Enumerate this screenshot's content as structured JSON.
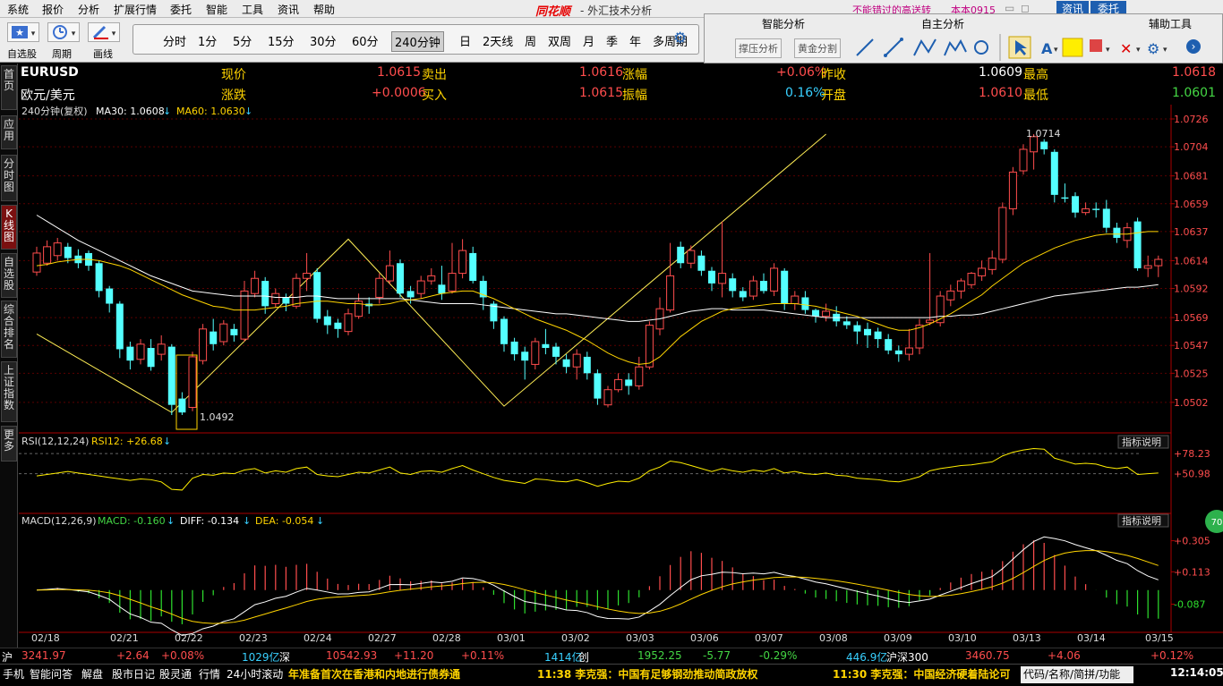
{
  "menu": [
    "系统",
    "报价",
    "分析",
    "扩展行情",
    "委托",
    "智能",
    "工具",
    "资讯",
    "帮助"
  ],
  "brand": "同花顺",
  "app_title": "- 外汇技术分析",
  "promo": "不能错过的高送转",
  "account": "本本0915",
  "top_buttons": [
    "资讯",
    "委托"
  ],
  "toolbar": {
    "watchlist": "自选股",
    "cycle": "周期",
    "draw": "画线"
  },
  "periods": [
    "分时",
    "1分",
    "5分",
    "15分",
    "30分",
    "60分",
    "240分钟",
    "日",
    "2天线",
    "周",
    "双周",
    "月",
    "季",
    "年",
    "多周期"
  ],
  "active_period": "240分钟",
  "right_panel": {
    "smart": "智能分析",
    "self": "自主分析",
    "aux": "辅助工具",
    "btn1": "撑压分析",
    "btn2": "黄金分割"
  },
  "side_tabs": [
    "首页",
    "应用",
    "分时图",
    "K线图",
    "自选股",
    "综合排名",
    "上证指数",
    "更多"
  ],
  "active_tab": "K线图",
  "quote": {
    "symbol": "EURUSD",
    "name": "欧元/美元",
    "now_label": "现价",
    "now": "1.0615",
    "sell_label": "卖出",
    "sell": "1.0616",
    "pct_label": "涨幅",
    "pct": "+0.06%",
    "prev_label": "昨收",
    "prev": "1.0609",
    "high_label": "最高",
    "high": "1.0618",
    "chg_label": "涨跌",
    "chg": "+0.0006",
    "buy_label": "买入",
    "buy": "1.0615",
    "amp_label": "振幅",
    "amp": "0.16%",
    "open_label": "开盘",
    "open": "1.0610",
    "low_label": "最低",
    "low": "1.0601"
  },
  "chart_data": {
    "type": "candlestick",
    "title": "240分钟(复权)",
    "ma30_label": "MA30: 1.0608",
    "ma60_label": "MA60: 1.0630",
    "ylim": [
      1.0492,
      1.0726
    ],
    "y_ticks": [
      "1.0726",
      "1.0704",
      "1.0681",
      "1.0659",
      "1.0637",
      "1.0614",
      "1.0592",
      "1.0569",
      "1.0547",
      "1.0525",
      "1.0502"
    ],
    "x_ticks": [
      "02/18",
      "02/21",
      "02/22",
      "02/23",
      "02/24",
      "02/27",
      "02/28",
      "03/01",
      "03/02",
      "03/03",
      "03/06",
      "03/07",
      "03/08",
      "03/09",
      "03/10",
      "03/13",
      "03/14",
      "03/15"
    ],
    "annot_high": "1.0714",
    "annot_low": "1.0492",
    "candles": [
      [
        1.0605,
        1.062,
        1.0625,
        1.0602
      ],
      [
        1.0612,
        1.0625,
        1.063,
        1.061
      ],
      [
        1.0618,
        1.0628,
        1.0632,
        1.0614
      ],
      [
        1.0625,
        1.0616,
        1.0628,
        1.0612
      ],
      [
        1.0618,
        1.0612,
        1.0623,
        1.0608
      ],
      [
        1.062,
        1.061,
        1.0622,
        1.0606
      ],
      [
        1.0612,
        1.059,
        1.0614,
        1.0585
      ],
      [
        1.0592,
        1.058,
        1.0594,
        1.0573
      ],
      [
        1.058,
        1.0544,
        1.0582,
        1.0537
      ],
      [
        1.0546,
        1.0535,
        1.055,
        1.0528
      ],
      [
        1.0536,
        1.0548,
        1.0552,
        1.0532
      ],
      [
        1.0545,
        1.053,
        1.0552,
        1.0527
      ],
      [
        1.054,
        1.0548,
        1.0555,
        1.0535
      ],
      [
        1.0546,
        1.05,
        1.0548,
        1.0492
      ],
      [
        1.0505,
        1.0494,
        1.051,
        1.0492
      ],
      [
        1.0498,
        1.0538,
        1.0542,
        1.0495
      ],
      [
        1.0535,
        1.056,
        1.0564,
        1.0532
      ],
      [
        1.0558,
        1.0548,
        1.0568,
        1.0543
      ],
      [
        1.055,
        1.0564,
        1.0567,
        1.0547
      ],
      [
        1.056,
        1.0555,
        1.0564,
        1.055
      ],
      [
        1.0552,
        1.059,
        1.0598,
        1.055
      ],
      [
        1.0588,
        1.06,
        1.0606,
        1.0585
      ],
      [
        1.0598,
        1.0578,
        1.0601,
        1.0572
      ],
      [
        1.058,
        1.0588,
        1.0592,
        1.0577
      ],
      [
        1.0585,
        1.058,
        1.0588,
        1.0574
      ],
      [
        1.0578,
        1.06,
        1.0604,
        1.0576
      ],
      [
        1.06,
        1.0604,
        1.062,
        1.059
      ],
      [
        1.0605,
        1.0568,
        1.0608,
        1.0565
      ],
      [
        1.057,
        1.0563,
        1.0575,
        1.0556
      ],
      [
        1.0565,
        1.056,
        1.0568,
        1.0553
      ],
      [
        1.0558,
        1.0572,
        1.0576,
        1.0555
      ],
      [
        1.057,
        1.0582,
        1.0588,
        1.0568
      ],
      [
        1.058,
        1.0578,
        1.0585,
        1.0572
      ],
      [
        1.0585,
        1.06,
        1.0604,
        1.058
      ],
      [
        1.0598,
        1.061,
        1.0622,
        1.0595
      ],
      [
        1.0612,
        1.0588,
        1.0615,
        1.0585
      ],
      [
        1.059,
        1.0585,
        1.0594,
        1.058
      ],
      [
        1.0588,
        1.0598,
        1.0602,
        1.0584
      ],
      [
        1.0598,
        1.0602,
        1.0608,
        1.0595
      ],
      [
        1.0595,
        1.0588,
        1.061,
        1.0583
      ],
      [
        1.059,
        1.0604,
        1.0628,
        1.0588
      ],
      [
        1.0604,
        1.0622,
        1.0631,
        1.06
      ],
      [
        1.062,
        1.0598,
        1.0625,
        1.0596
      ],
      [
        1.0598,
        1.0585,
        1.0602,
        1.0575
      ],
      [
        1.058,
        1.0566,
        1.0582,
        1.056
      ],
      [
        1.0568,
        1.0548,
        1.057,
        1.0542
      ],
      [
        1.055,
        1.054,
        1.0553,
        1.0535
      ],
      [
        1.0542,
        1.0535,
        1.0546,
        1.052
      ],
      [
        1.0532,
        1.055,
        1.0553,
        1.0528
      ],
      [
        1.0548,
        1.0545,
        1.056,
        1.054
      ],
      [
        1.0546,
        1.0538,
        1.0549,
        1.0532
      ],
      [
        1.0536,
        1.053,
        1.054,
        1.0525
      ],
      [
        1.053,
        1.054,
        1.0544,
        1.052
      ],
      [
        1.0538,
        1.0525,
        1.0542,
        1.052
      ],
      [
        1.0525,
        1.0505,
        1.0528,
        1.05
      ],
      [
        1.05,
        1.0512,
        1.0515,
        1.0498
      ],
      [
        1.0512,
        1.052,
        1.0525,
        1.051
      ],
      [
        1.052,
        1.0515,
        1.0525,
        1.0508
      ],
      [
        1.0515,
        1.053,
        1.0538,
        1.0512
      ],
      [
        1.053,
        1.0563,
        1.0566,
        1.0528
      ],
      [
        1.056,
        1.0576,
        1.0585,
        1.0555
      ],
      [
        1.0575,
        1.0602,
        1.0628,
        1.0573
      ],
      [
        1.0625,
        1.0612,
        1.0629,
        1.0608
      ],
      [
        1.0612,
        1.0622,
        1.0626,
        1.0608
      ],
      [
        1.0618,
        1.0606,
        1.0622,
        1.0602
      ],
      [
        1.0606,
        1.0596,
        1.0609,
        1.059
      ],
      [
        1.0596,
        1.0604,
        1.0645,
        1.0585
      ],
      [
        1.06,
        1.059,
        1.0604,
        1.0585
      ],
      [
        1.059,
        1.0585,
        1.0593,
        1.0582
      ],
      [
        1.0586,
        1.0598,
        1.0602,
        1.0583
      ],
      [
        1.0598,
        1.059,
        1.0604,
        1.0588
      ],
      [
        1.059,
        1.0608,
        1.0612,
        1.0586
      ],
      [
        1.0606,
        1.058,
        1.0608,
        1.0575
      ],
      [
        1.058,
        1.0586,
        1.059,
        1.0575
      ],
      [
        1.0585,
        1.0575,
        1.059,
        1.0572
      ],
      [
        1.0575,
        1.057,
        1.0576,
        1.0565
      ],
      [
        1.057,
        1.0574,
        1.058,
        1.0566
      ],
      [
        1.0572,
        1.0566,
        1.0578,
        1.0562
      ],
      [
        1.0566,
        1.0563,
        1.057,
        1.056
      ],
      [
        1.0563,
        1.0558,
        1.0566,
        1.0548
      ],
      [
        1.056,
        1.0555,
        1.0565,
        1.0545
      ],
      [
        1.0558,
        1.0552,
        1.0561,
        1.0545
      ],
      [
        1.0552,
        1.0543,
        1.0556,
        1.054
      ],
      [
        1.0543,
        1.054,
        1.0547,
        1.0534
      ],
      [
        1.054,
        1.0545,
        1.056,
        1.0535
      ],
      [
        1.0545,
        1.0563,
        1.0568,
        1.054
      ],
      [
        1.0565,
        1.0567,
        1.062,
        1.0563
      ],
      [
        1.0565,
        1.0586,
        1.059,
        1.0562
      ],
      [
        1.0583,
        1.059,
        1.0595,
        1.0578
      ],
      [
        1.059,
        1.0598,
        1.06,
        1.0584
      ],
      [
        1.0595,
        1.0604,
        1.0605,
        1.0592
      ],
      [
        1.0602,
        1.0608,
        1.0614,
        1.0598
      ],
      [
        1.0607,
        1.0616,
        1.0622,
        1.0603
      ],
      [
        1.0615,
        1.0656,
        1.066,
        1.0612
      ],
      [
        1.0655,
        1.0684,
        1.0688,
        1.065
      ],
      [
        1.0685,
        1.0702,
        1.0706,
        1.0682
      ],
      [
        1.07,
        1.0712,
        1.0714,
        1.0686
      ],
      [
        1.0708,
        1.0702,
        1.071,
        1.0698
      ],
      [
        1.07,
        1.0666,
        1.0702,
        1.066
      ],
      [
        1.0664,
        1.0663,
        1.0675,
        1.066
      ],
      [
        1.0665,
        1.0652,
        1.0668,
        1.0648
      ],
      [
        1.0652,
        1.0655,
        1.066,
        1.065
      ],
      [
        1.0655,
        1.0654,
        1.066,
        1.0648
      ],
      [
        1.0655,
        1.064,
        1.0662,
        1.0636
      ],
      [
        1.064,
        1.0632,
        1.0644,
        1.0628
      ],
      [
        1.063,
        1.064,
        1.0644,
        1.0624
      ],
      [
        1.0645,
        1.0608,
        1.0648,
        1.0606
      ],
      [
        1.0608,
        1.061,
        1.0618,
        1.0601
      ],
      [
        1.061,
        1.0615,
        1.0618,
        1.0601
      ]
    ],
    "ma30": [
      1.065,
      1.0645,
      1.064,
      1.0635,
      1.063,
      1.0626,
      1.0622,
      1.0618,
      1.0614,
      1.061,
      1.0606,
      1.0602,
      1.0599,
      1.0596,
      1.0593,
      1.059,
      1.0589,
      1.0588,
      1.0587,
      1.0586,
      1.0586,
      1.0586,
      1.0586,
      1.0585,
      1.0585,
      1.0585,
      1.0586,
      1.0586,
      1.0585,
      1.0584,
      1.0584,
      1.0584,
      1.0584,
      1.0584,
      1.0584,
      1.0584,
      1.0583,
      1.0582,
      1.0581,
      1.058,
      1.058,
      1.058,
      1.058,
      1.0579,
      1.0578,
      1.0577,
      1.0576,
      1.0575,
      1.0574,
      1.0573,
      1.0572,
      1.0572,
      1.0571,
      1.057,
      1.0569,
      1.0568,
      1.0567,
      1.0566,
      1.0566,
      1.0567,
      1.0568,
      1.057,
      1.0572,
      1.0574,
      1.0575,
      1.0576,
      1.0576,
      1.0575,
      1.0575,
      1.0575,
      1.0575,
      1.0574,
      1.0573,
      1.0572,
      1.0571,
      1.057,
      1.0569,
      1.0569,
      1.0569,
      1.0569,
      1.0569,
      1.0569,
      1.0569,
      1.0569,
      1.0569,
      1.0569,
      1.0569,
      1.057,
      1.057,
      1.0571,
      1.0571,
      1.0572,
      1.0574,
      1.0576,
      1.0578,
      1.058,
      1.0582,
      1.0584,
      1.0586,
      1.0587,
      1.0588,
      1.0589,
      1.059,
      1.0591,
      1.0592,
      1.0593,
      1.0593,
      1.0594,
      1.0595
    ],
    "ma60": [
      1.061,
      1.0611,
      1.0613,
      1.0614,
      1.0615,
      1.0615,
      1.0614,
      1.0612,
      1.061,
      1.0607,
      1.0603,
      1.0599,
      1.0595,
      1.0591,
      1.0587,
      1.0584,
      1.0581,
      1.0578,
      1.0577,
      1.0575,
      1.0575,
      1.0575,
      1.0576,
      1.0577,
      1.0578,
      1.058,
      1.0581,
      1.0582,
      1.0582,
      1.0581,
      1.058,
      1.058,
      1.0579,
      1.0579,
      1.058,
      1.0582,
      1.0583,
      1.0584,
      1.0586,
      1.0588,
      1.0589,
      1.059,
      1.059,
      1.0587,
      1.0584,
      1.058,
      1.0576,
      1.0572,
      1.0568,
      1.0565,
      1.0562,
      1.0559,
      1.0555,
      1.0551,
      1.0546,
      1.0541,
      1.0537,
      1.0534,
      1.0532,
      1.0533,
      1.0538,
      1.0546,
      1.0554,
      1.056,
      1.0566,
      1.057,
      1.0574,
      1.0576,
      1.0577,
      1.0578,
      1.0579,
      1.058,
      1.058,
      1.058,
      1.0579,
      1.0578,
      1.0576,
      1.0574,
      1.0572,
      1.057,
      1.0567,
      1.0564,
      1.0561,
      1.0559,
      1.0559,
      1.0561,
      1.0564,
      1.0568,
      1.0572,
      1.0577,
      1.0582,
      1.0587,
      1.0594,
      1.06,
      1.0606,
      1.0612,
      1.0616,
      1.062,
      1.0624,
      1.0627,
      1.063,
      1.0632,
      1.0634,
      1.0635,
      1.0635,
      1.0635,
      1.0636,
      1.0637,
      1.0637
    ],
    "zigzag_points": [
      [
        0,
        1.0556
      ],
      [
        13,
        1.0494
      ],
      [
        30,
        1.0631
      ],
      [
        45,
        1.0499
      ],
      [
        76,
        1.0714
      ]
    ],
    "rsi": {
      "label": "RSI(12,12,24)",
      "value_label": "RSI12: +26.68",
      "ticks": [
        "+78.23",
        "+50.98"
      ],
      "ylim": [
        0,
        100
      ],
      "hline_top": 78.23,
      "hline_mid": 50.98,
      "values": [
        48,
        50,
        52,
        54,
        52,
        50,
        48,
        46,
        44,
        42,
        44,
        43,
        40,
        30,
        29,
        45,
        50,
        49,
        52,
        51,
        56,
        58,
        52,
        55,
        53,
        58,
        60,
        50,
        48,
        47,
        50,
        53,
        52,
        56,
        60,
        52,
        50,
        54,
        55,
        53,
        58,
        62,
        56,
        51,
        46,
        42,
        40,
        38,
        44,
        43,
        41,
        40,
        43,
        39,
        34,
        38,
        41,
        40,
        45,
        55,
        60,
        68,
        66,
        62,
        58,
        54,
        58,
        55,
        53,
        56,
        54,
        58,
        52,
        54,
        51,
        50,
        52,
        49,
        48,
        45,
        44,
        43,
        41,
        40,
        43,
        47,
        55,
        58,
        60,
        62,
        63,
        65,
        67,
        75,
        80,
        83,
        85,
        84,
        72,
        68,
        64,
        65,
        64,
        60,
        58,
        60,
        50,
        51,
        52
      ]
    },
    "macd": {
      "label": "MACD(12,26,9)",
      "macd_label": "MACD: -0.160",
      "diff_label": "DIFF: -0.134",
      "dea_label": "DEA: -0.054",
      "ticks": [
        "+0.305",
        "+0.113",
        "-0.087"
      ],
      "ylim": [
        -0.25,
        0.38
      ]
    },
    "info_button": "指标说明"
  },
  "ticker": [
    {
      "t": "沪",
      "c": "wht"
    },
    {
      "t": "3241.97",
      "c": "red"
    },
    {
      "t": "+2.64",
      "c": "red"
    },
    {
      "t": "+0.08%",
      "c": "red"
    },
    {
      "t": "1029亿",
      "c": "cyan"
    },
    {
      "t": "深",
      "c": "wht"
    },
    {
      "t": "10542.93",
      "c": "red"
    },
    {
      "t": "+11.20",
      "c": "red"
    },
    {
      "t": "+0.11%",
      "c": "red"
    },
    {
      "t": "1414亿",
      "c": "cyan"
    },
    {
      "t": "创",
      "c": "wht"
    },
    {
      "t": "1952.25",
      "c": "green"
    },
    {
      "t": "-5.77",
      "c": "green"
    },
    {
      "t": "-0.29%",
      "c": "green"
    },
    {
      "t": "446.9亿",
      "c": "cyan"
    },
    {
      "t": "沪深300",
      "c": "wht"
    },
    {
      "t": "3460.75",
      "c": "red"
    },
    {
      "t": "+4.06",
      "c": "red"
    },
    {
      "t": "+0.12%",
      "c": "red"
    }
  ],
  "status": {
    "items": [
      "手机",
      "智能问答",
      "解盘",
      "股市日记",
      "股灵通",
      "行情",
      "24小时滚动"
    ],
    "news": [
      "年准备首次在香港和内地进行债券通",
      "11:38 李克强：中国有足够钢劲推动简政放权",
      "11:30 李克强：中国经济硬着陆论可"
    ],
    "search": "代码/名称/简拼/功能",
    "clock": "12:14:05",
    "badge": "70"
  }
}
